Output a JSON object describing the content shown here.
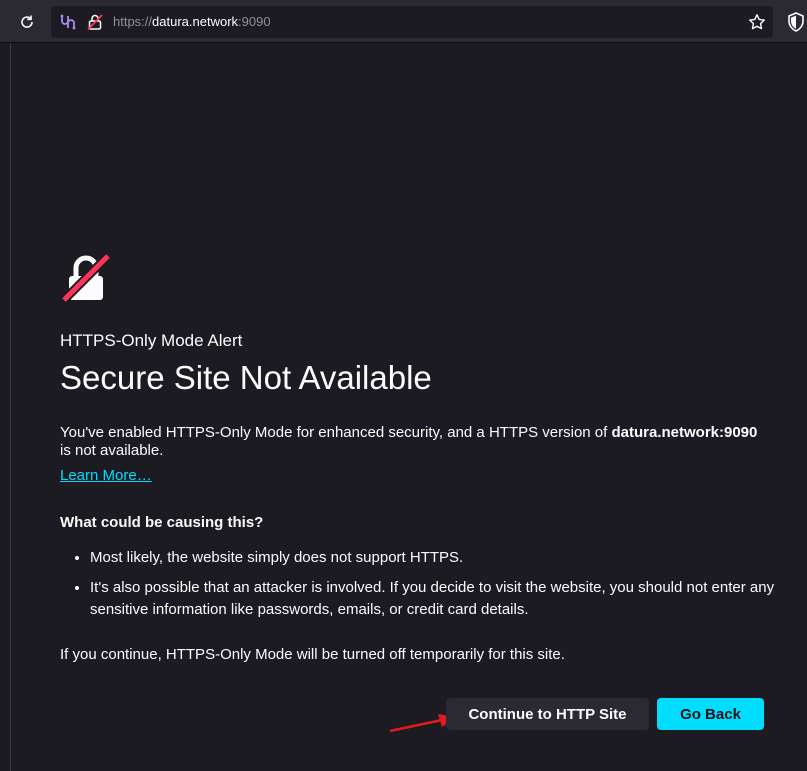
{
  "browser": {
    "url_prefix": "https://",
    "url_host": "datura.network",
    "url_port": ":9090"
  },
  "page": {
    "subtitle": "HTTPS-Only Mode Alert",
    "title": "Secure Site Not Available",
    "desc_before": "You've enabled HTTPS-Only Mode for enhanced security, and a HTTPS version of ",
    "desc_host": "datura.network:9090",
    "desc_after": " is not available.",
    "learn_more": "Learn More…",
    "cause_heading": "What could be causing this?",
    "causes": [
      "Most likely, the website simply does not support HTTPS.",
      "It's also possible that an attacker is involved. If you decide to visit the website, you should not enter any sensitive information like passwords, emails, or credit card details."
    ],
    "footer": "If you continue, HTTPS-Only Mode will be turned off temporarily for this site.",
    "continue_button": "Continue to HTTP Site",
    "back_button": "Go Back"
  },
  "colors": {
    "accent": "#00ddff",
    "warning": "#ff3358",
    "annotation_arrow": "#e31b1b"
  },
  "icons": [
    "reload-icon",
    "extension-icon",
    "insecure-lock-icon",
    "bookmark-star-icon",
    "shield-icon",
    "broken-lock-icon"
  ]
}
